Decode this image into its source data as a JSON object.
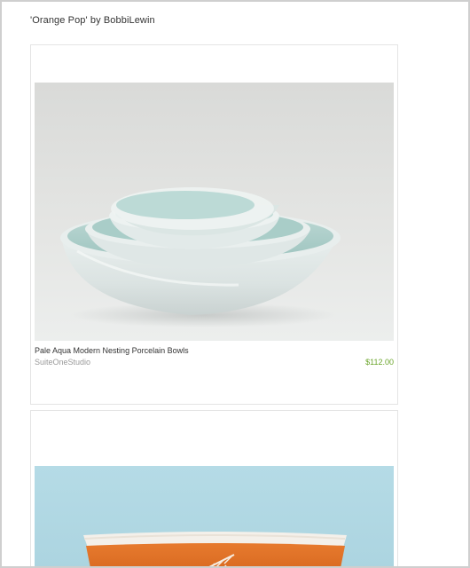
{
  "treasury": {
    "title": "'Orange Pop' by BobbiLewin"
  },
  "listings": [
    {
      "title": "Pale Aqua Modern Nesting Porcelain Bowls",
      "shop": "SuiteOneStudio",
      "price": "$112.00",
      "image": "nesting-porcelain-bowls-photo"
    },
    {
      "image": "orange-bowl-photo"
    }
  ],
  "colors": {
    "price": "#6aa42a",
    "shop": "#9a9a9a",
    "frame": "#cfcfcf"
  }
}
